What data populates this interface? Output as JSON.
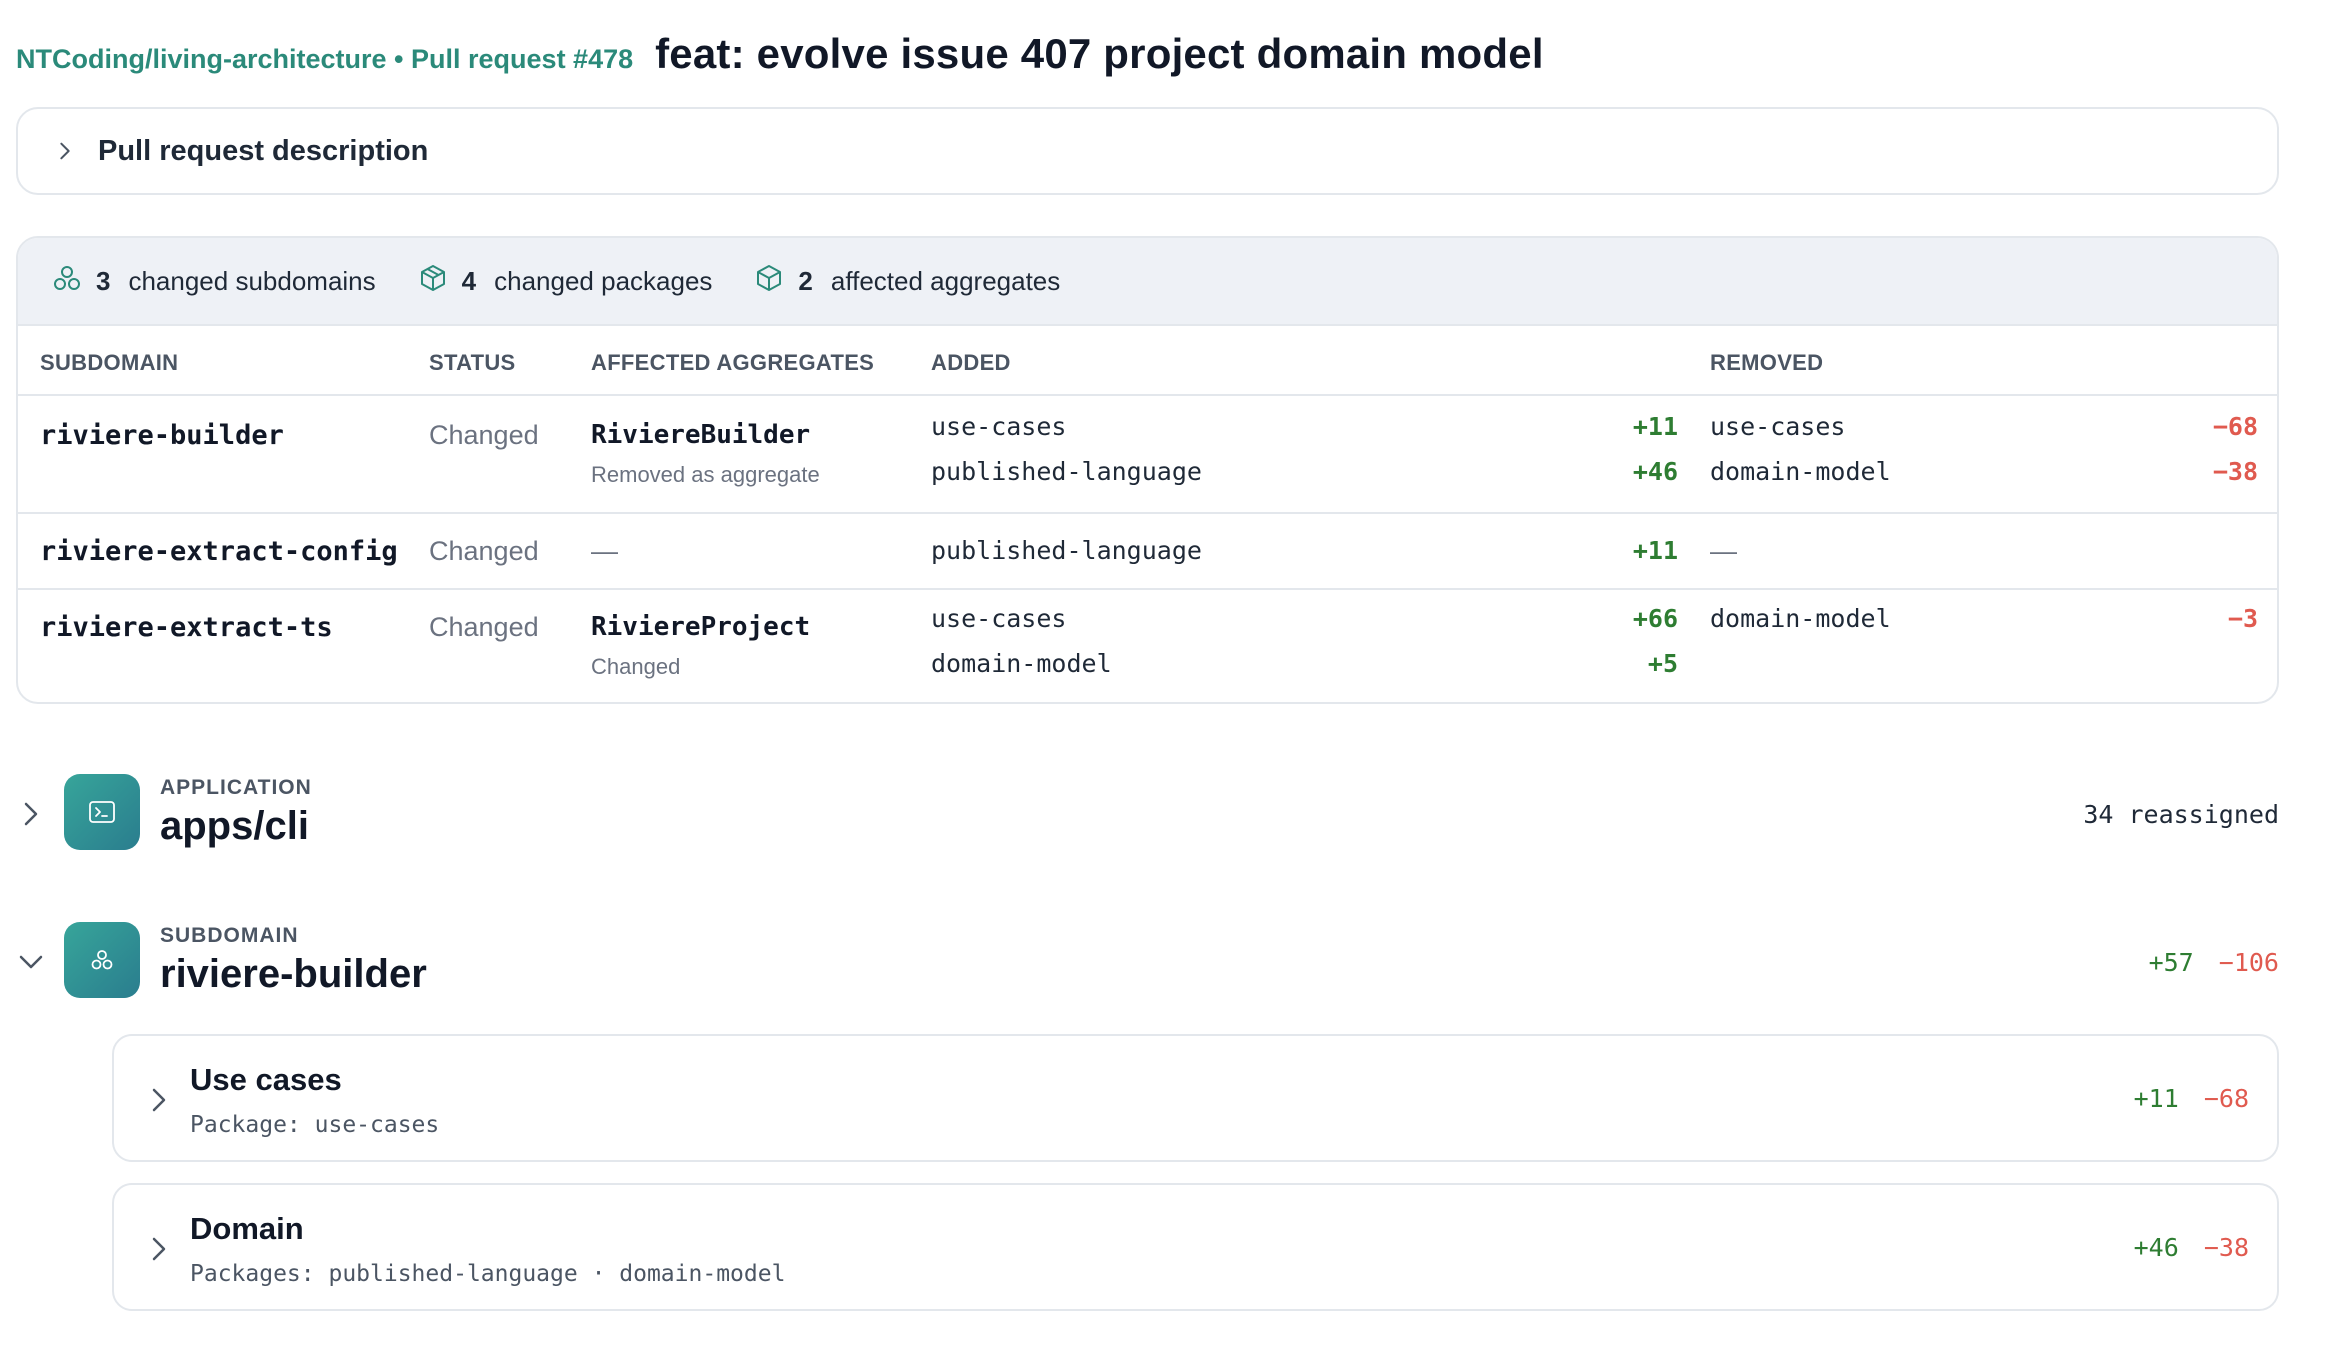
{
  "header": {
    "repo": "NTCoding/living-architecture",
    "pr_label": "Pull request #478",
    "title": "feat: evolve issue 407 project domain model"
  },
  "description_panel": {
    "label": "Pull request description"
  },
  "summary": {
    "stats": [
      {
        "icon": "subdomain-icon",
        "count": "3",
        "label": "changed subdomains"
      },
      {
        "icon": "package-icon",
        "count": "4",
        "label": "changed packages"
      },
      {
        "icon": "aggregate-icon",
        "count": "2",
        "label": "affected aggregates"
      }
    ],
    "columns": {
      "subdomain": "SUBDOMAIN",
      "status": "STATUS",
      "aggregates": "AFFECTED AGGREGATES",
      "added": "ADDED",
      "removed": "REMOVED"
    },
    "rows": [
      {
        "subdomain": "riviere-builder",
        "status": "Changed",
        "aggregate": "RiviereBuilder",
        "aggregate_note": "Removed as aggregate",
        "added": [
          {
            "pkg": "use-cases",
            "delta": "+11"
          },
          {
            "pkg": "published-language",
            "delta": "+46"
          }
        ],
        "removed": [
          {
            "pkg": "use-cases",
            "delta": "−68"
          },
          {
            "pkg": "domain-model",
            "delta": "−38"
          }
        ]
      },
      {
        "subdomain": "riviere-extract-config",
        "status": "Changed",
        "aggregate": "—",
        "aggregate_note": "",
        "added": [
          {
            "pkg": "published-language",
            "delta": "+11"
          }
        ],
        "removed_empty": "—"
      },
      {
        "subdomain": "riviere-extract-ts",
        "status": "Changed",
        "aggregate": "RiviereProject",
        "aggregate_note": "Changed",
        "added": [
          {
            "pkg": "use-cases",
            "delta": "+66"
          },
          {
            "pkg": "domain-model",
            "delta": "+5"
          }
        ],
        "removed": [
          {
            "pkg": "domain-model",
            "delta": "−3"
          }
        ]
      }
    ]
  },
  "sections": [
    {
      "kind": "APPLICATION",
      "title": "apps/cli",
      "icon": "terminal-icon",
      "expanded": false,
      "right_text": "34 reassigned"
    },
    {
      "kind": "SUBDOMAIN",
      "title": "riviere-builder",
      "icon": "subdomain-icon",
      "expanded": true,
      "added": "+57",
      "removed": "−106"
    }
  ],
  "packages": [
    {
      "title": "Use cases",
      "subtitle": "Package: use-cases",
      "added": "+11",
      "removed": "−68"
    },
    {
      "title": "Domain",
      "subtitle": "Packages: published-language · domain-model",
      "added": "+46",
      "removed": "−38"
    }
  ],
  "colors": {
    "accent": "#2b8a7a",
    "added": "#2e7d32",
    "removed": "#e05a4f",
    "summary_header_bg": "#eef1f6",
    "tile_gradient_start": "#37a59a",
    "tile_gradient_end": "#2a7d8e"
  }
}
